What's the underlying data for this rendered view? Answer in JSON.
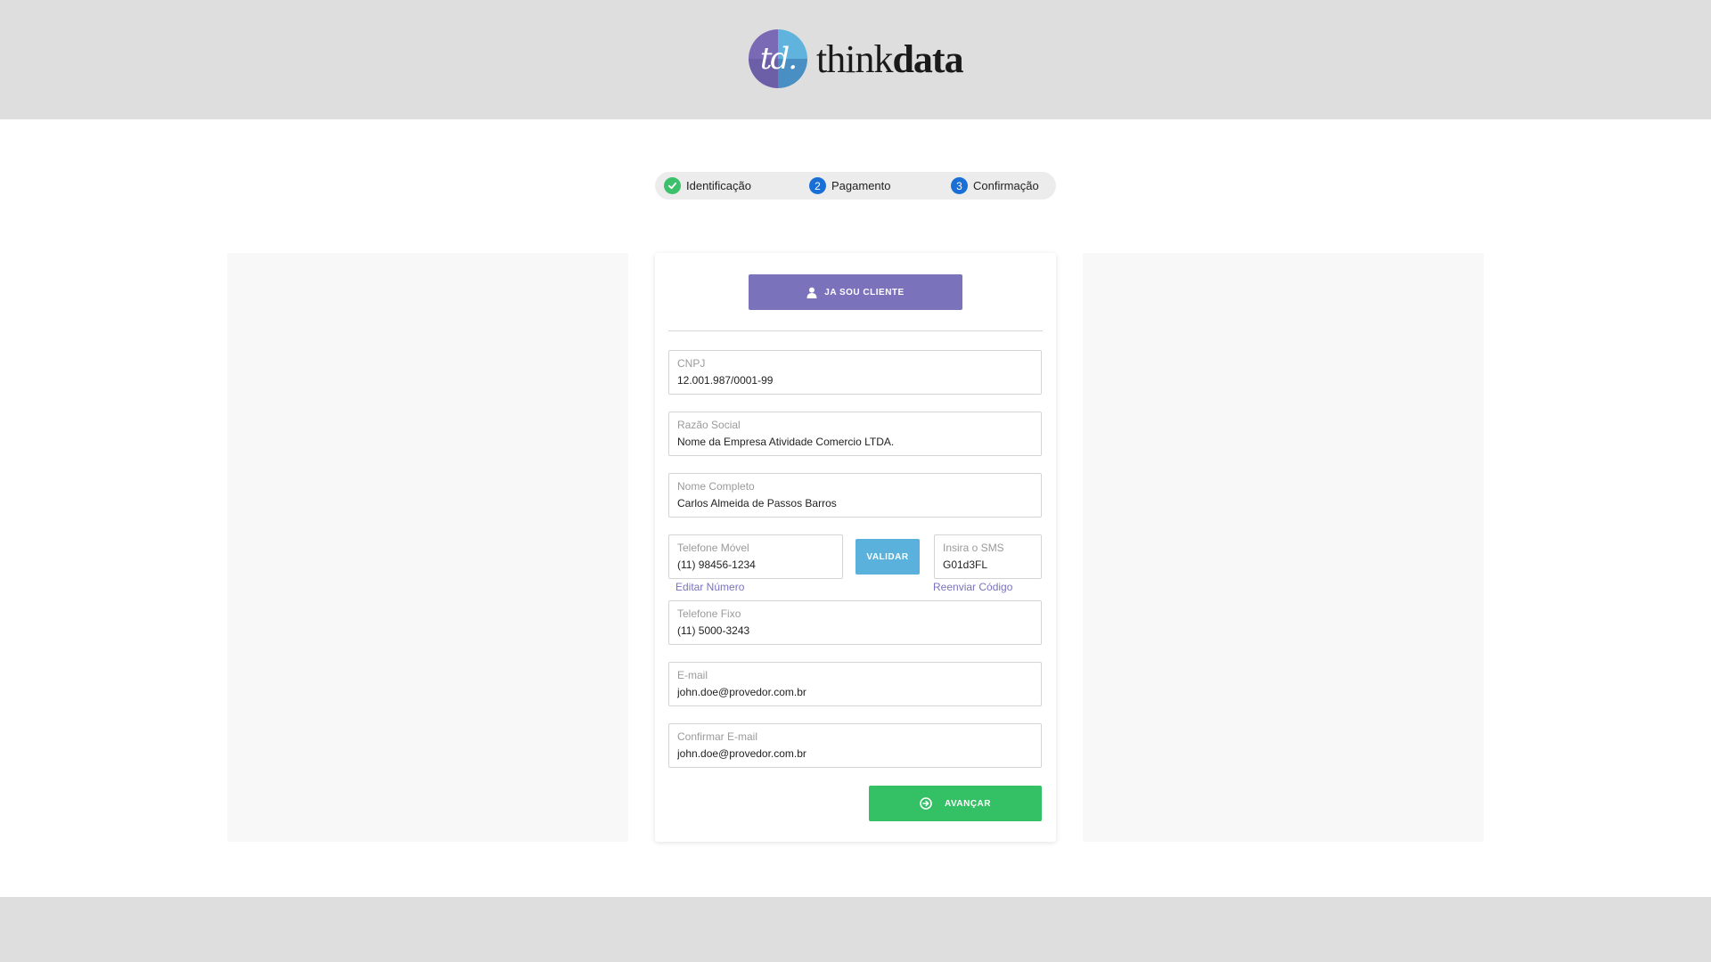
{
  "brand": {
    "logo_mark": "td.",
    "name_part1": "think",
    "name_part2": "data"
  },
  "stepper": {
    "steps": [
      {
        "number": "",
        "label": "Identificação",
        "status": "done",
        "icon": "check-icon"
      },
      {
        "number": "2",
        "label": "Pagamento",
        "status": "pending"
      },
      {
        "number": "3",
        "label": "Confirmação",
        "status": "pending"
      }
    ]
  },
  "form": {
    "client_button": "JA SOU CLIENTE",
    "client_button_icon": "user-icon",
    "fields": {
      "cnpj": {
        "label": "CNPJ",
        "value": "12.001.987/0001-99"
      },
      "razao_social": {
        "label": "Razão Social",
        "value": "Nome da Empresa Atividade Comercio LTDA."
      },
      "nome_completo": {
        "label": "Nome Completo",
        "value": "Carlos Almeida de Passos Barros"
      },
      "telefone_movel": {
        "label": "Telefone Móvel",
        "value": "(11) 98456-1234"
      },
      "sms": {
        "label": "Insira o SMS",
        "value": "G01d3FL"
      },
      "telefone_fixo": {
        "label": "Telefone Fixo",
        "value": "(11) 5000-3243"
      },
      "email": {
        "label": "E-mail",
        "value": "john.doe@provedor.com.br"
      },
      "confirmar_email": {
        "label": "Confirmar E-mail",
        "value": "john.doe@provedor.com.br"
      }
    },
    "validar_button": "VALIDAR",
    "editar_numero_link": "Editar Número",
    "reenviar_codigo_link": "Reenviar Código",
    "avancar_button": "AVANÇAR",
    "avancar_icon": "arrow-circle-right-icon"
  },
  "colors": {
    "header_bg": "#dedede",
    "accent_purple": "#7a73bc",
    "accent_blue": "#5ab2dc",
    "success_green": "#34c065",
    "step_blue": "#1a6fd6"
  }
}
